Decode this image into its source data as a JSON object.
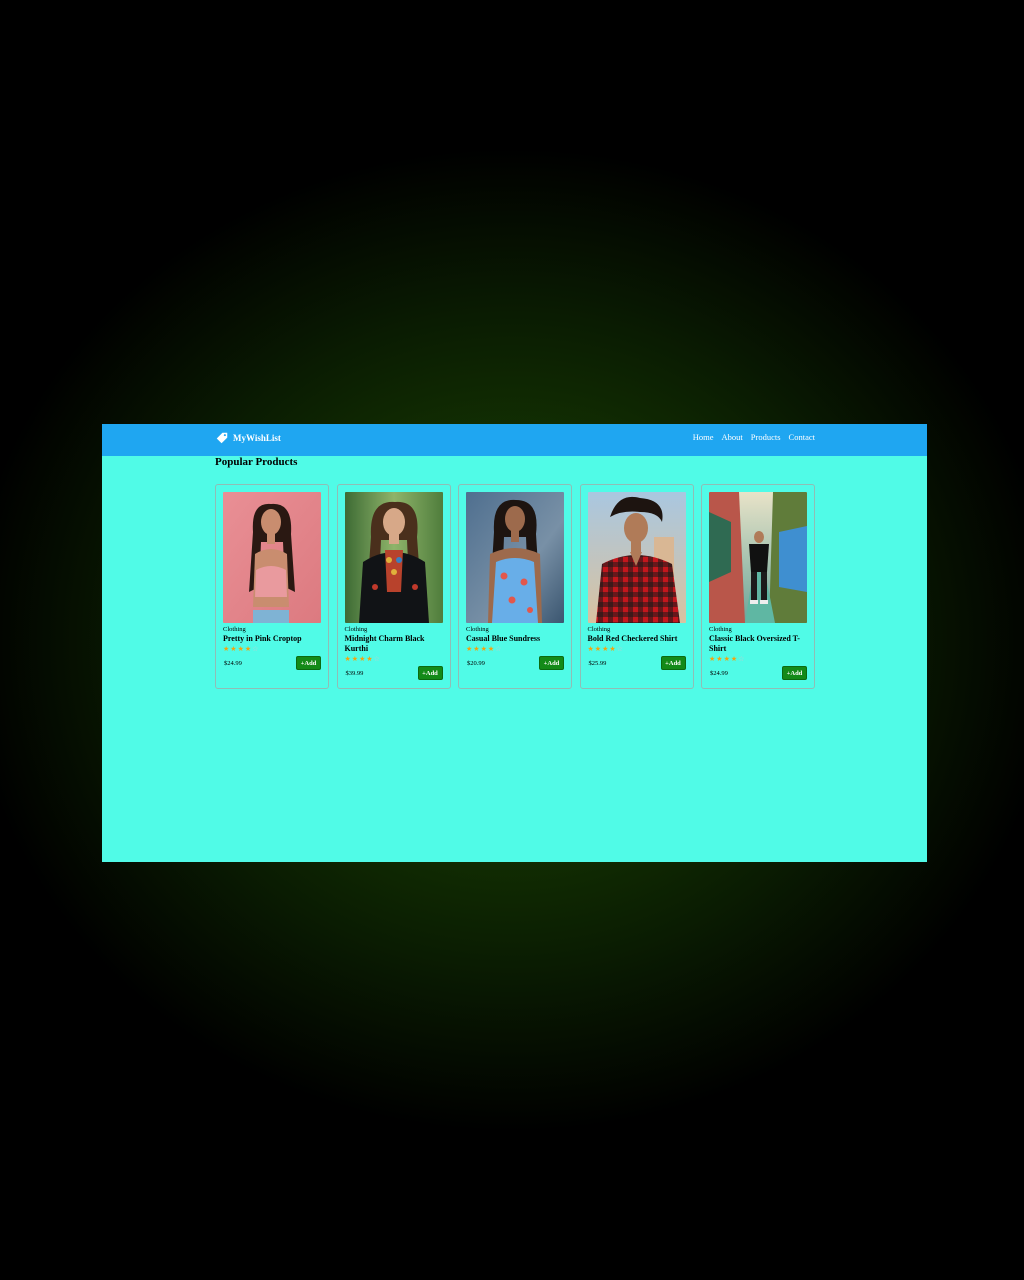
{
  "nav": {
    "brand": "MyWishList",
    "links": [
      "Home",
      "About",
      "Products",
      "Contact"
    ]
  },
  "section_title": "Popular Products",
  "products": [
    {
      "category": "Clothing",
      "name": "Pretty in Pink Croptop",
      "price": "$24.99",
      "rating": 4,
      "button": "+Add"
    },
    {
      "category": "Clothing",
      "name": "Midnight Charm Black Kurthi",
      "price": "$39.99",
      "rating": 4,
      "button": "+Add"
    },
    {
      "category": "Clothing",
      "name": "Casual Blue Sundress",
      "price": "$20.99",
      "rating": 4,
      "button": "+Add"
    },
    {
      "category": "Clothing",
      "name": "Bold Red Checkered Shirt",
      "price": "$25.99",
      "rating": 4,
      "button": "+Add"
    },
    {
      "category": "Clothing",
      "name": "Classic Black Oversized T-Shirt",
      "price": "$24.99",
      "rating": 4,
      "button": "+Add"
    }
  ],
  "colors": {
    "navbar": "#1fa6f1",
    "page_background": "#50fbe7",
    "add_button": "#138a18",
    "star": "#f3a40f"
  }
}
